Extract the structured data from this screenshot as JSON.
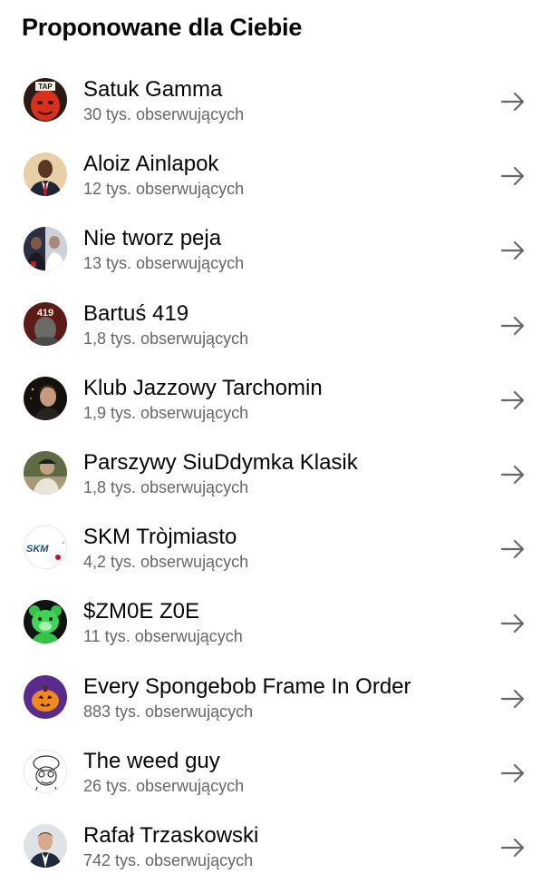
{
  "header": {
    "title": "Proponowane dla Ciebie"
  },
  "suggestions": [
    {
      "name": "Satuk Gamma",
      "followers": "30 tys. obserwujących",
      "avatar_icon": "red-face-avatar-icon",
      "avatar_badge": "TAP"
    },
    {
      "name": "Aloiz Ainlapok",
      "followers": "12 tys. obserwujących",
      "avatar_icon": "man-in-suit-avatar-icon"
    },
    {
      "name": "Nie tworz peja",
      "followers": "13 tys. obserwujących",
      "avatar_icon": "group-photo-avatar-icon"
    },
    {
      "name": "Bartuś 419",
      "followers": "1,8 tys. obserwujących",
      "avatar_icon": "419-avatar-icon",
      "avatar_badge": "419"
    },
    {
      "name": "Klub Jazzowy Tarchomin",
      "followers": "1,9 tys. obserwujących",
      "avatar_icon": "dark-portrait-avatar-icon"
    },
    {
      "name": "Parszywy SiuDdymka Klasik",
      "followers": "1,8 tys. obserwujących",
      "avatar_icon": "man-with-cap-avatar-icon"
    },
    {
      "name": "SKM Tròjmiasto",
      "followers": "4,2 tys. obserwujących",
      "avatar_icon": "skm-logo-avatar-icon",
      "avatar_badge": "SKM"
    },
    {
      "name": "$ZM0E Z0E",
      "followers": "11 tys. obserwujących",
      "avatar_icon": "green-bear-avatar-icon"
    },
    {
      "name": "Every Spongebob Frame In Order",
      "followers": "883 tys. obserwujących",
      "avatar_icon": "pumpkin-avatar-icon"
    },
    {
      "name": "The weed guy",
      "followers": "26 tys. obserwujących",
      "avatar_icon": "cartoon-sketch-avatar-icon"
    },
    {
      "name": "Rafał Trzaskowski",
      "followers": "742 tys. obserwujących",
      "avatar_icon": "man-portrait-avatar-icon"
    }
  ],
  "colors": {
    "text_primary": "#050505",
    "text_secondary": "#65676b",
    "arrow": "#65676b",
    "background": "#ffffff"
  }
}
